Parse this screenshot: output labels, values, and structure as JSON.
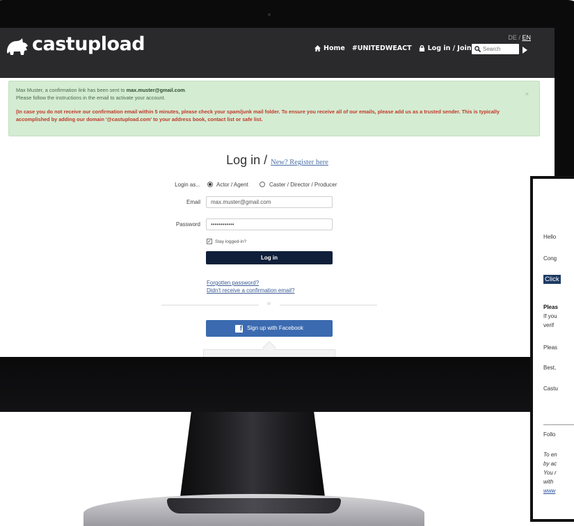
{
  "header": {
    "logo_text": "castupload",
    "lang_de": "DE",
    "lang_sep": "/",
    "lang_en": "EN",
    "nav": [
      {
        "label": "Home",
        "icon": "home-icon"
      },
      {
        "label": "#UNITEDWEACT",
        "icon": ""
      },
      {
        "label": "Log in / Join",
        "icon": "lock-icon"
      }
    ],
    "search_placeholder": "Search"
  },
  "alert": {
    "line1_prefix": "Max Muster, a confirmation link has been sent to ",
    "line1_email": "max.muster@gmail.com",
    "line1_suffix": ".",
    "line2": "Please follow the instructions in the email to activate your account.",
    "warning": "(In case you do not receive our confirmation email within 5 minutes, please check your spam/junk mail folder. To ensure you receive all of our emails, please add us as a trusted sender. This is typically accomplished by adding our domain '@castupload.com' to your address book, contact list or safe list.",
    "close": "×"
  },
  "login": {
    "title": "Log in /",
    "register_link": "New? Register here",
    "login_as_label": "Login as...",
    "role_actor": "Actor / Agent",
    "role_caster": "Caster / Director / Producer",
    "email_label": "Email",
    "email_value": "max.muster@gmail.com",
    "password_label": "Password",
    "password_value": "••••••••••••",
    "stay_logged_in": "Stay logged-in?",
    "login_button": "Log in",
    "forgot_password": "Forgotten password?",
    "resend_confirmation": "Didn't receive a confirmation email?",
    "or": "or",
    "facebook_button": "Sign up with Facebook"
  },
  "email_preview": {
    "lines": [
      "Hello",
      "Cong",
      "Click",
      "Pleas",
      "If you",
      "verif",
      "Pleas",
      "Best,",
      "Castu",
      "Follo",
      "To en",
      "by ac",
      "You r",
      "with",
      "www"
    ]
  },
  "colors": {
    "topbar": "#2a2a2d",
    "alert_bg": "#d4ecd2",
    "warning_text": "#c0392b",
    "login_button": "#0f1f3a",
    "facebook_button": "#3b6ab0"
  }
}
